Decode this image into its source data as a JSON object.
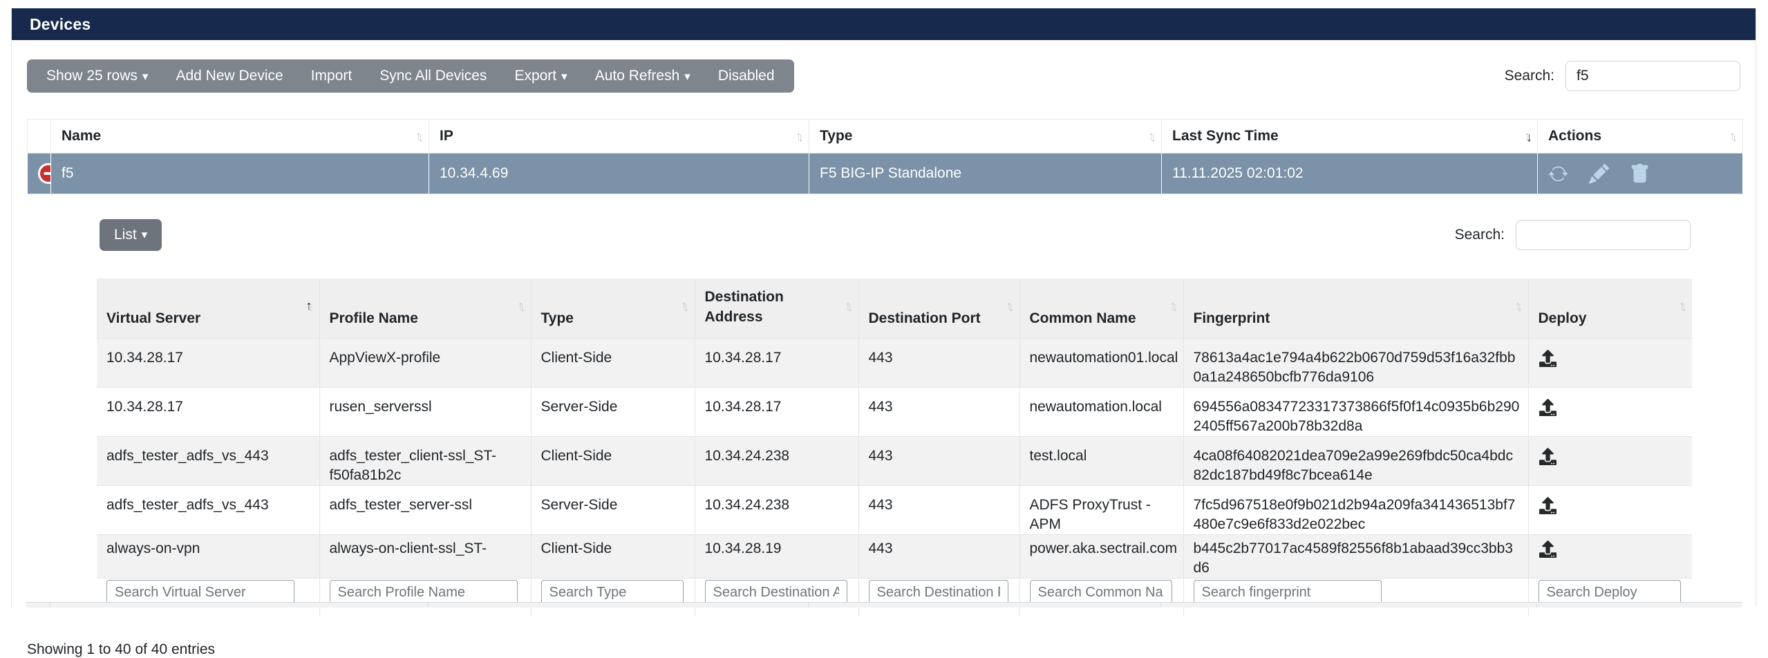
{
  "colors": {
    "header_bg": "#172a4d",
    "toolbar_bg": "#7e858d",
    "list_button_bg": "#6e747c",
    "selected_row_bg": "#7b92a8",
    "action_icon": "#bcd4e8",
    "collapse_icon": "#c9302c",
    "subheader_bg": "#efefef",
    "row_alt_bg": "#f2f2f2"
  },
  "icons": {
    "sort_asc": "↑",
    "sort_desc": "↓",
    "caret_down": "▾"
  },
  "titlebar": {
    "title": "Devices"
  },
  "toolbar": {
    "buttons": [
      {
        "label": "Show 25 rows",
        "dropdown": true
      },
      {
        "label": "Add New Device",
        "dropdown": false
      },
      {
        "label": "Import",
        "dropdown": false
      },
      {
        "label": "Sync All Devices",
        "dropdown": false
      },
      {
        "label": "Export",
        "dropdown": true
      },
      {
        "label": "Auto Refresh",
        "dropdown": true
      },
      {
        "label": "Disabled",
        "dropdown": false
      }
    ],
    "search_label": "Search:",
    "search_value": "f5"
  },
  "devices_table": {
    "columns": [
      "Name",
      "IP",
      "Type",
      "Last Sync Time",
      "Actions"
    ],
    "sort": {
      "column": "Last Sync Time",
      "direction": "desc"
    },
    "rows": [
      {
        "name": "f5",
        "ip": "10.34.4.69",
        "type": "F5 BIG-IP Standalone",
        "last_sync_time": "11.11.2025 02:01:02",
        "actions": [
          "sync",
          "edit",
          "delete"
        ]
      }
    ]
  },
  "detail": {
    "list_button_label": "List",
    "search_label": "Search:",
    "search_value": "",
    "table": {
      "columns": [
        "Virtual Server",
        "Profile Name",
        "Type",
        "Destination Address",
        "Destination Port",
        "Common Name",
        "Fingerprint",
        "Deploy"
      ],
      "sort": {
        "column": "Virtual Server",
        "direction": "asc"
      },
      "rows": [
        {
          "virtual_server": "10.34.28.17",
          "profile_name": "AppViewX-profile",
          "type": "Client-Side",
          "destination_address": "10.34.28.17",
          "destination_port": "443",
          "common_name": "newautomation01.local",
          "fingerprint": "78613a4ac1e794a4b622b0670d759d53f16a32fbb0a1a248650bcfb776da9106"
        },
        {
          "virtual_server": "10.34.28.17",
          "profile_name": "rusen_serverssl",
          "type": "Server-Side",
          "destination_address": "10.34.28.17",
          "destination_port": "443",
          "common_name": "newautomation.local",
          "fingerprint": "694556a08347723317373866f5f0f14c0935b6b2902405ff567a200b78b32d8a"
        },
        {
          "virtual_server": "adfs_tester_adfs_vs_443",
          "profile_name": "adfs_tester_client-ssl_ST-f50fa81b2c",
          "type": "Client-Side",
          "destination_address": "10.34.24.238",
          "destination_port": "443",
          "common_name": "test.local",
          "fingerprint": "4ca08f64082021dea709e2a99e269fbdc50ca4bdc82dc187bd49f8c7bcea614e"
        },
        {
          "virtual_server": "adfs_tester_adfs_vs_443",
          "profile_name": "adfs_tester_server-ssl",
          "type": "Server-Side",
          "destination_address": "10.34.24.238",
          "destination_port": "443",
          "common_name": "ADFS ProxyTrust - APM",
          "fingerprint": "7fc5d967518e0f9b021d2b94a209fa341436513bf7480e7c9e6f833d2e022bec"
        },
        {
          "virtual_server": "always-on-vpn",
          "profile_name": "always-on-client-ssl_ST-",
          "type": "Client-Side",
          "destination_address": "10.34.28.19",
          "destination_port": "443",
          "common_name": "power.aka.sectrail.com",
          "fingerprint": "b445c2b77017ac4589f82556f8b1abaad39cc3bb3d6"
        }
      ],
      "search_placeholders": [
        "Search Virtual Server",
        "Search Profile Name",
        "Search Type",
        "Search Destination Address",
        "Search Destination Port",
        "Search Common Name",
        "Search fingerprint",
        "Search Deploy"
      ]
    },
    "info": "Showing 1 to 40 of 40 entries"
  }
}
